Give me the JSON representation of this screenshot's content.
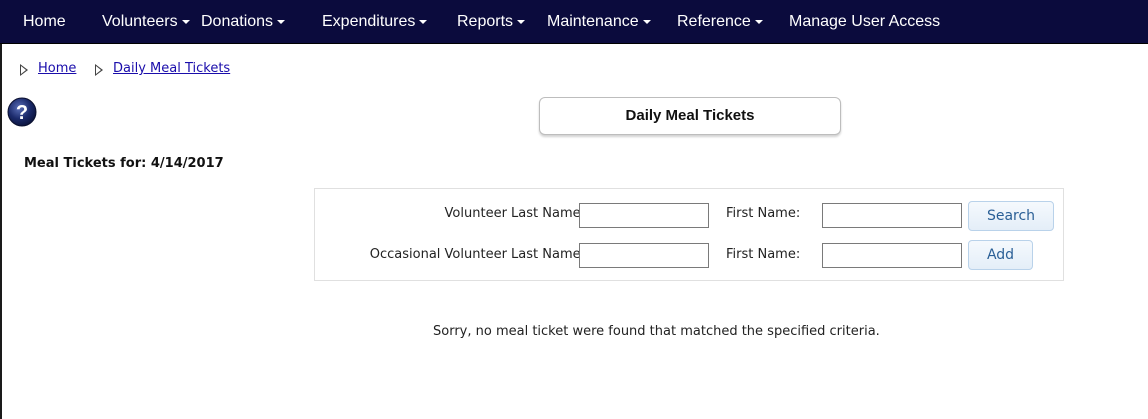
{
  "nav": {
    "home": "Home",
    "volunteers": "Volunteers",
    "donations": "Donations",
    "expenditures": "Expenditures",
    "reports": "Reports",
    "maintenance": "Maintenance",
    "reference": "Reference",
    "manage_user_access": "Manage User Access"
  },
  "breadcrumb": {
    "items": [
      "Home",
      "Daily Meal Tickets"
    ]
  },
  "page_title": "Daily Meal Tickets",
  "date_label": "Meal Tickets for: 4/14/2017",
  "search": {
    "volunteer_last_label": "Volunteer Last Name:",
    "volunteer_first_label": "First Name:",
    "occasional_last_label": "Occasional Volunteer Last Name:",
    "occasional_first_label": "First Name:",
    "volunteer_last_value": "",
    "volunteer_first_value": "",
    "occasional_last_value": "",
    "occasional_first_value": "",
    "search_button": "Search",
    "add_button": "Add"
  },
  "message": "Sorry, no meal ticket were found that matched the specified criteria.",
  "colors": {
    "navbar_bg": "#0b0b3d",
    "link": "#1a0dab",
    "button_text": "#2a5f96",
    "help_icon": "#1b2a6b"
  },
  "icons": {
    "help": "help-icon",
    "breadcrumb_arrow": "triangle-right-icon",
    "dropdown": "caret-down-icon"
  }
}
